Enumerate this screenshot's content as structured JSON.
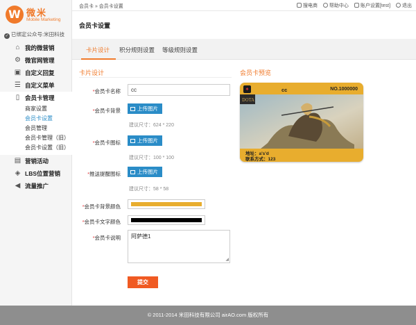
{
  "brand": {
    "logo_letter": "W",
    "name_cn": "微米",
    "name_en": "Mobile Marketing"
  },
  "account": {
    "bound_text": "已绑定公众号:米田科技"
  },
  "sidebar": {
    "items": [
      {
        "label": "我的微营销",
        "icon": "home-icon"
      },
      {
        "label": "微官网管理",
        "icon": "gear-icon"
      },
      {
        "label": "自定义回复",
        "icon": "reply-icon"
      },
      {
        "label": "自定义菜单",
        "icon": "menu-icon"
      }
    ],
    "card_group": {
      "label": "会员卡管理",
      "icon": "phone-icon",
      "subs": [
        "商家设置",
        "会员卡设置",
        "会员管理",
        "会员卡管理（旧）",
        "会员卡设置（旧）"
      ],
      "active_index": 1
    },
    "after": [
      {
        "label": "营销活动",
        "icon": "activity-icon"
      },
      {
        "label": "LBS位置营销",
        "icon": "location-icon"
      },
      {
        "label": "流量推广",
        "icon": "megaphone-icon"
      }
    ]
  },
  "breadcrumb": "会员卡 » 会员卡设置",
  "toplinks": [
    "搜电商",
    "帮助中心",
    "账户设置[test]",
    "退出"
  ],
  "page_title": "会员卡设置",
  "tabs": [
    "卡片设计",
    "积分规则设置",
    "等级规则设置"
  ],
  "form": {
    "section_title": "卡片设计",
    "name_label": "会员卡名称",
    "name_value": "cc",
    "bg_label": "会员卡背景",
    "upload_label": "上传图片",
    "bg_hint": "建议尺寸：624 * 220",
    "icon_label": "会员卡图标",
    "icon_hint": "建议尺寸：100 * 100",
    "push_label": "推送提醒图标",
    "push_hint": "建议尺寸：58 * 58",
    "bgcolor_label": "会员卡背景颜色",
    "bgcolor_value": "#e8ad2e",
    "textcolor_label": "会员卡文字颜色",
    "textcolor_value": "#000000",
    "desc_label": "会员卡说明",
    "desc_value": "阿萨德1",
    "submit_label": "提交"
  },
  "preview": {
    "title": "会员卡预览",
    "card_name": "cc",
    "card_no": "NO.1000000",
    "address": "地址：a's'd",
    "contact": "联系方式：123",
    "logo_text": "DOTA"
  },
  "footer": "© 2011-2014 米田科技有限公司 airAO.com 版权所有",
  "colors": {
    "accent": "#f07a2b",
    "link": "#2a8cc7",
    "submit": "#f05a22"
  }
}
